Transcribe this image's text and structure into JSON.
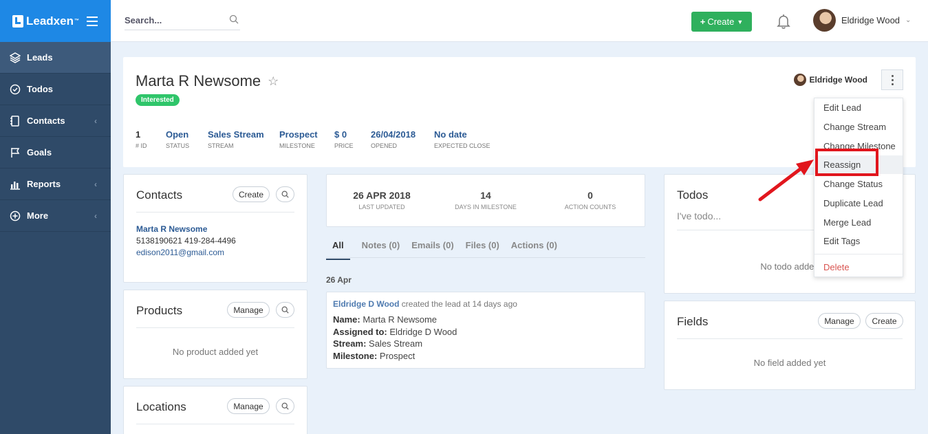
{
  "brand": {
    "name": "Leadxen",
    "tm": "™"
  },
  "sidebar": {
    "items": [
      {
        "label": "Leads",
        "icon": "layers-icon"
      },
      {
        "label": "Todos",
        "icon": "check-circle-icon"
      },
      {
        "label": "Contacts",
        "icon": "address-book-icon",
        "has_chevron": true
      },
      {
        "label": "Goals",
        "icon": "flag-icon"
      },
      {
        "label": "Reports",
        "icon": "bar-chart-icon",
        "has_chevron": true
      },
      {
        "label": "More",
        "icon": "plus-circle-icon",
        "has_chevron": true
      }
    ]
  },
  "topbar": {
    "search_placeholder": "Search...",
    "create_label": "Create",
    "user_name": "Eldridge Wood"
  },
  "lead": {
    "name": "Marta R Newsome",
    "status_badge": "Interested",
    "owner": "Eldridge Wood",
    "meta": [
      {
        "value": "1",
        "label": "# ID"
      },
      {
        "value": "Open",
        "label": "STATUS"
      },
      {
        "value": "Sales Stream",
        "label": "STREAM"
      },
      {
        "value": "Prospect",
        "label": "MILESTONE"
      },
      {
        "value": "$ 0",
        "label": "PRICE"
      },
      {
        "value": "26/04/2018",
        "label": "OPENED"
      },
      {
        "value": "No date",
        "label": "EXPECTED CLOSE"
      }
    ]
  },
  "contacts": {
    "title": "Contacts",
    "create_label": "Create",
    "name": "Marta R Newsome",
    "phones": "5138190621 419-284-4496",
    "email": "edison2011@gmail.com"
  },
  "products": {
    "title": "Products",
    "manage_label": "Manage",
    "empty": "No product added yet"
  },
  "locations": {
    "title": "Locations",
    "manage_label": "Manage"
  },
  "stats": [
    {
      "value": "26 APR 2018",
      "label": "LAST UPDATED"
    },
    {
      "value": "14",
      "label": "DAYS IN MILESTONE"
    },
    {
      "value": "0",
      "label": "ACTION COUNTS"
    }
  ],
  "tabs": [
    "All",
    "Notes (0)",
    "Emails (0)",
    "Files (0)",
    "Actions (0)"
  ],
  "timeline": {
    "date": "26 Apr",
    "actor": "Eldridge D Wood",
    "action": " created the lead at 14 days ago",
    "lines": [
      {
        "k": "Name:",
        "v": " Marta R Newsome"
      },
      {
        "k": "Assigned to:",
        "v": " Eldridge D Wood"
      },
      {
        "k": "Stream:",
        "v": " Sales Stream"
      },
      {
        "k": "Milestone:",
        "v": " Prospect"
      }
    ]
  },
  "todos": {
    "title": "Todos",
    "placeholder": "I've todo...",
    "empty": "No todo added"
  },
  "fields": {
    "title": "Fields",
    "manage_label": "Manage",
    "create_label": "Create",
    "empty": "No field added yet"
  },
  "menu": {
    "items": [
      "Edit Lead",
      "Change Stream",
      "Change Milestone",
      "Reassign",
      "Change Status",
      "Duplicate Lead",
      "Merge Lead",
      "Edit Tags"
    ],
    "delete_label": "Delete"
  },
  "colors": {
    "sidebar": "#2f4a68",
    "brand": "#1e88e5",
    "create": "#2fb05d",
    "highlight": "#e1161d",
    "link": "#2b5a94"
  }
}
